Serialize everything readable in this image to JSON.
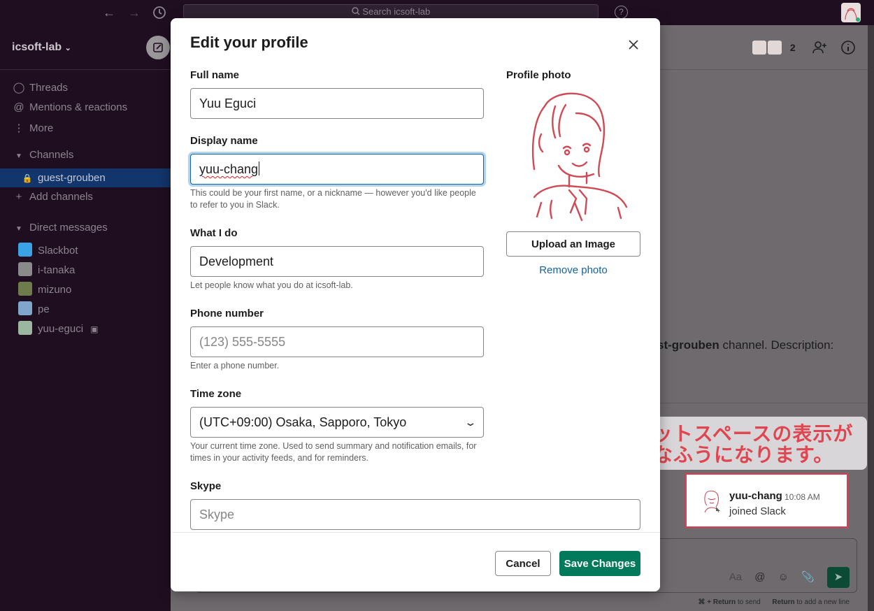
{
  "topbar": {
    "search_placeholder": "Search icsoft-lab",
    "help_glyph": "?",
    "icons": [
      "back-arrow-icon",
      "forward-arrow-icon",
      "history-clock-icon",
      "search-icon",
      "help-icon"
    ]
  },
  "sidebar": {
    "workspace": "icsoft-lab",
    "items": [
      {
        "icon": "threads-icon",
        "label": "Threads"
      },
      {
        "icon": "at-icon",
        "label": "Mentions & reactions"
      },
      {
        "icon": "more-dots-icon",
        "label": "More"
      }
    ],
    "channels_header": "Channels",
    "channels": [
      {
        "label": "guest-grouben",
        "active": true
      }
    ],
    "add_channels": "Add channels",
    "dm_header": "Direct messages",
    "dms": [
      {
        "label": "Slackbot",
        "color": "#3aa3e3"
      },
      {
        "label": "i-tanaka",
        "color": "#8a8a8a"
      },
      {
        "label": "mizuno",
        "color": "#6e7b4a"
      },
      {
        "label": "pe",
        "color": "#7fa7c9"
      },
      {
        "label": "yuu-eguci",
        "color": "#9bb7a0"
      }
    ]
  },
  "main": {
    "member_count": "2",
    "channel_desc_bold": "st-grouben",
    "channel_desc_rest": " channel. Description:",
    "composer_placeholder": "Aa",
    "hint_bold_1": "⌘ + Return",
    "hint_text_1": " to send",
    "hint_bold_2": "Return",
    "hint_text_2": " to add a new line"
  },
  "annotation": {
    "line1": "チャットスペースの表示が",
    "line2": "こんなふうになります。",
    "message_name": "yuu-chang",
    "message_time": "10:08 AM",
    "message_text": "joined Slack"
  },
  "modal": {
    "title": "Edit your profile",
    "full_name": {
      "label": "Full name",
      "value": "Yuu Eguci"
    },
    "display_name": {
      "label": "Display name",
      "value": "yuu-chang",
      "help": "This could be your first name, or a nickname — however you'd like people to refer to you in Slack."
    },
    "what_i_do": {
      "label": "What I do",
      "value": "Development",
      "help": "Let people know what you do at icsoft-lab."
    },
    "phone": {
      "label": "Phone number",
      "placeholder": "(123) 555-5555",
      "help": "Enter a phone number."
    },
    "time_zone": {
      "label": "Time zone",
      "value": "(UTC+09:00) Osaka, Sapporo, Tokyo",
      "help": "Your current time zone. Used to send summary and notification emails, for times in your activity feeds, and for reminders."
    },
    "skype": {
      "label": "Skype",
      "placeholder": "Skype"
    },
    "profile_photo": {
      "label": "Profile photo",
      "upload": "Upload an Image",
      "remove": "Remove photo"
    },
    "cancel": "Cancel",
    "save": "Save Changes"
  },
  "colors": {
    "accent_green": "#007a5a",
    "link_blue": "#1264a3",
    "annotation_red": "#e04650"
  }
}
